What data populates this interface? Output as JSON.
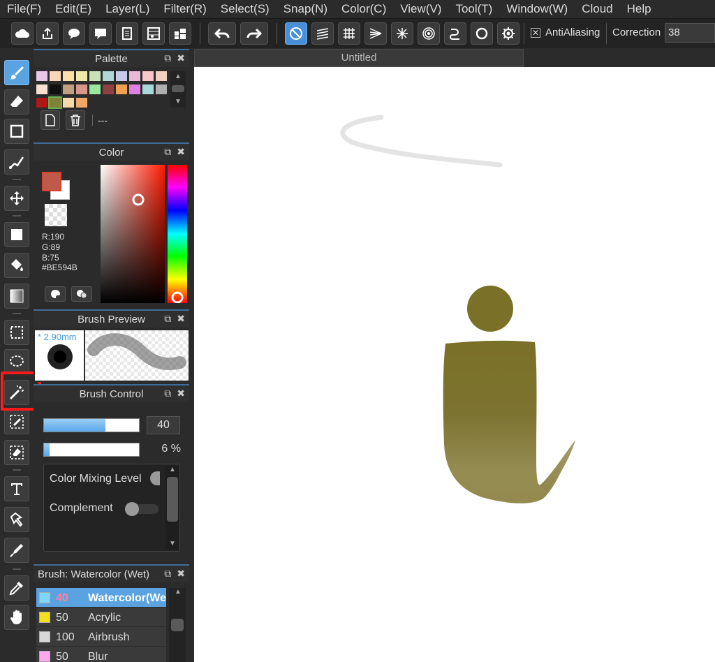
{
  "menu": [
    "File(F)",
    "Edit(E)",
    "Layer(L)",
    "Filter(R)",
    "Select(S)",
    "Snap(N)",
    "Color(C)",
    "View(V)",
    "Tool(T)",
    "Window(W)",
    "Cloud",
    "Help"
  ],
  "toolbar": {
    "antialiasing_label": "AntiAliasing",
    "correction_label": "Correction",
    "correction_value": "38"
  },
  "palette": {
    "title": "Palette",
    "name": "---",
    "swatches": [
      "#e8c7e8",
      "#f8d8b8",
      "#f8e0a8",
      "#f0e8a8",
      "#c8e0b8",
      "#b0d8d8",
      "#c8c8e8",
      "#e8b8d8",
      "#f8c8c8",
      "#f0d0c0",
      "#f8e0d0",
      "#101010",
      "#c0a080",
      "#d89888",
      "#98e8a0",
      "#904040",
      "#f0a050",
      "#e080e0",
      "#a8d8d8",
      "#b0b0b0",
      "#b01818",
      "#808038",
      "#f8d8a8",
      "#f0a868"
    ]
  },
  "color": {
    "title": "Color",
    "main_hex": "#BE594B",
    "r": "R:190",
    "g": "G:89",
    "b": "B:75",
    "hex": "#BE594B"
  },
  "preview": {
    "title": "Brush Preview",
    "size_text": "* 2.90mm"
  },
  "control": {
    "title": "Brush Control",
    "size_value": "40",
    "size_fill": 0.65,
    "density_value": "6 %",
    "density_fill": 0.06,
    "color_mixing_label": "Color Mixing Level",
    "complement_label": "Complement"
  },
  "brushes": {
    "title": "Brush: Watercolor (Wet)",
    "items": [
      {
        "size": "40",
        "name": "Watercolor(Wet)",
        "color": "#7fd6f5",
        "selected": true
      },
      {
        "size": "50",
        "name": "Acrylic",
        "color": "#f5e020",
        "selected": false
      },
      {
        "size": "100",
        "name": "Airbrush",
        "color": "#d8d8d8",
        "selected": false
      },
      {
        "size": "50",
        "name": "Blur",
        "color": "#ffa8f0",
        "selected": false
      }
    ]
  },
  "document": {
    "tab_title": "Untitled"
  },
  "canvas": {
    "stroke_color": "#7e7530"
  }
}
